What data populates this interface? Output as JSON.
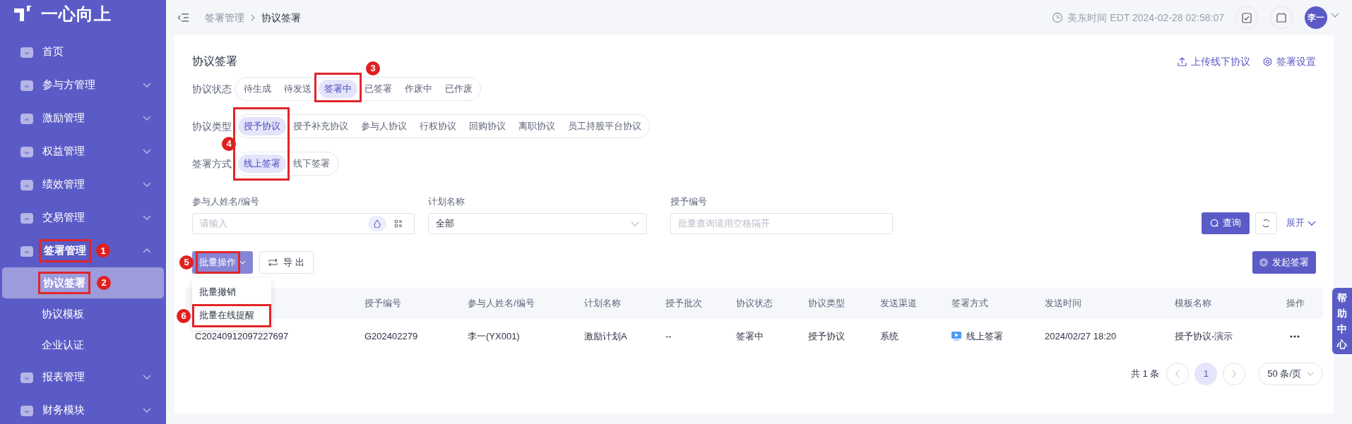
{
  "logo": {
    "text": "一心向上"
  },
  "sidebar": {
    "items": [
      {
        "label": "首页",
        "kind": "link"
      },
      {
        "label": "参与方管理",
        "kind": "group",
        "expanded": false
      },
      {
        "label": "激励管理",
        "kind": "group",
        "expanded": false
      },
      {
        "label": "权益管理",
        "kind": "group",
        "expanded": false
      },
      {
        "label": "绩效管理",
        "kind": "group",
        "expanded": false
      },
      {
        "label": "交易管理",
        "kind": "group",
        "expanded": false
      },
      {
        "label": "签署管理",
        "kind": "group",
        "expanded": true,
        "step": "1",
        "children": [
          {
            "label": "协议签署",
            "selected": true,
            "step": "2"
          },
          {
            "label": "协议模板",
            "selected": false
          },
          {
            "label": "企业认证",
            "selected": false
          }
        ]
      },
      {
        "label": "报表管理",
        "kind": "group",
        "expanded": false
      },
      {
        "label": "财务模块",
        "kind": "group",
        "expanded": false
      }
    ]
  },
  "header": {
    "breadcrumb": [
      "签署管理",
      "协议签署"
    ],
    "time": "美东时间 EDT 2024-02-28 02:58:07",
    "user": "李一"
  },
  "page": {
    "title": "协议签署",
    "actions": [
      {
        "label": "上传线下协议",
        "kind": "upload"
      },
      {
        "label": "签署设置",
        "kind": "settings"
      }
    ]
  },
  "filters": [
    {
      "label": "协议状态",
      "options": [
        {
          "label": "待生成",
          "selected": false
        },
        {
          "label": "待发送",
          "selected": false
        },
        {
          "label": "签署中",
          "selected": true,
          "step": "3"
        },
        {
          "label": "已签署",
          "selected": false
        },
        {
          "label": "作废中",
          "selected": false
        },
        {
          "label": "已作废",
          "selected": false
        }
      ]
    },
    {
      "label": "协议类型",
      "options": [
        {
          "label": "授予协议",
          "selected": true
        },
        {
          "label": "授予补充协议",
          "selected": false
        },
        {
          "label": "参与人协议",
          "selected": false
        },
        {
          "label": "行权协议",
          "selected": false
        },
        {
          "label": "回购协议",
          "selected": false
        },
        {
          "label": "离职协议",
          "selected": false
        },
        {
          "label": "员工持股平台协议",
          "selected": false
        }
      ]
    },
    {
      "label": "签署方式",
      "options": [
        {
          "label": "线上签署",
          "selected": true
        },
        {
          "label": "线下签署",
          "selected": false
        }
      ]
    }
  ],
  "filters_step": "4",
  "search_fields": [
    {
      "label": "参与人姓名/编号",
      "kind": "text-tools",
      "placeholder": "请输入"
    },
    {
      "label": "计划名称",
      "kind": "select",
      "value": "全部"
    },
    {
      "label": "授予编号",
      "kind": "text",
      "placeholder": "批量查询请用空格隔开"
    }
  ],
  "query_button": "查询",
  "expand_link": "展开",
  "toolbar": {
    "batch_button": "批量操作",
    "batch_step": "5",
    "export_button": "导 出",
    "create_button": "发起签署"
  },
  "batch_menu": [
    {
      "label": "批量撤销"
    },
    {
      "label": "批量在线提醒",
      "step": "6"
    }
  ],
  "table": {
    "columns": [
      "",
      "授予编号",
      "参与人姓名/编号",
      "计划名称",
      "授予批次",
      "协议状态",
      "协议类型",
      "发送渠道",
      "签署方式",
      "发送时间",
      "模板名称",
      "操作"
    ],
    "rows": [
      [
        "C20240912097227697",
        "G202402279",
        "李一(YX001)",
        "激励计划A",
        "--",
        "签署中",
        "授予协议",
        "系统",
        "线上签署",
        "2024/02/27 18:20",
        "授予协议-演示"
      ]
    ]
  },
  "pagination": {
    "total": "共 1 条",
    "pages": [
      {
        "label": "1",
        "selected": true
      }
    ],
    "page_size": "50 条/页"
  },
  "help_tab": "帮助中心"
}
